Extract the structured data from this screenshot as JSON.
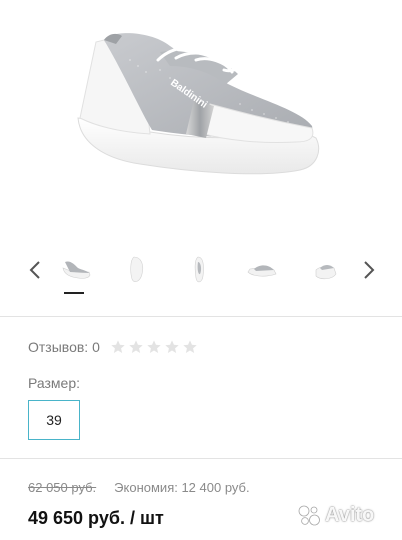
{
  "product": {
    "brand_text": "Baldinini"
  },
  "gallery": {
    "thumbnails": [
      {
        "name": "thumb-side-view",
        "active": true
      },
      {
        "name": "thumb-sole-view",
        "active": false
      },
      {
        "name": "thumb-top-view",
        "active": false
      },
      {
        "name": "thumb-back-view",
        "active": false
      },
      {
        "name": "thumb-front-view",
        "active": false
      }
    ]
  },
  "reviews": {
    "label": "Отзывов: 0",
    "rating": 0,
    "max_rating": 5
  },
  "size": {
    "title": "Размер:",
    "selected": "39"
  },
  "pricing": {
    "old_price": "62 050 руб.",
    "savings": "Экономия: 12 400 руб.",
    "current_price": "49 650 руб. / шт"
  },
  "watermark": {
    "text": "Avito"
  },
  "colors": {
    "accent_border": "#49b4c9",
    "star_empty": "#e3e3e3"
  }
}
